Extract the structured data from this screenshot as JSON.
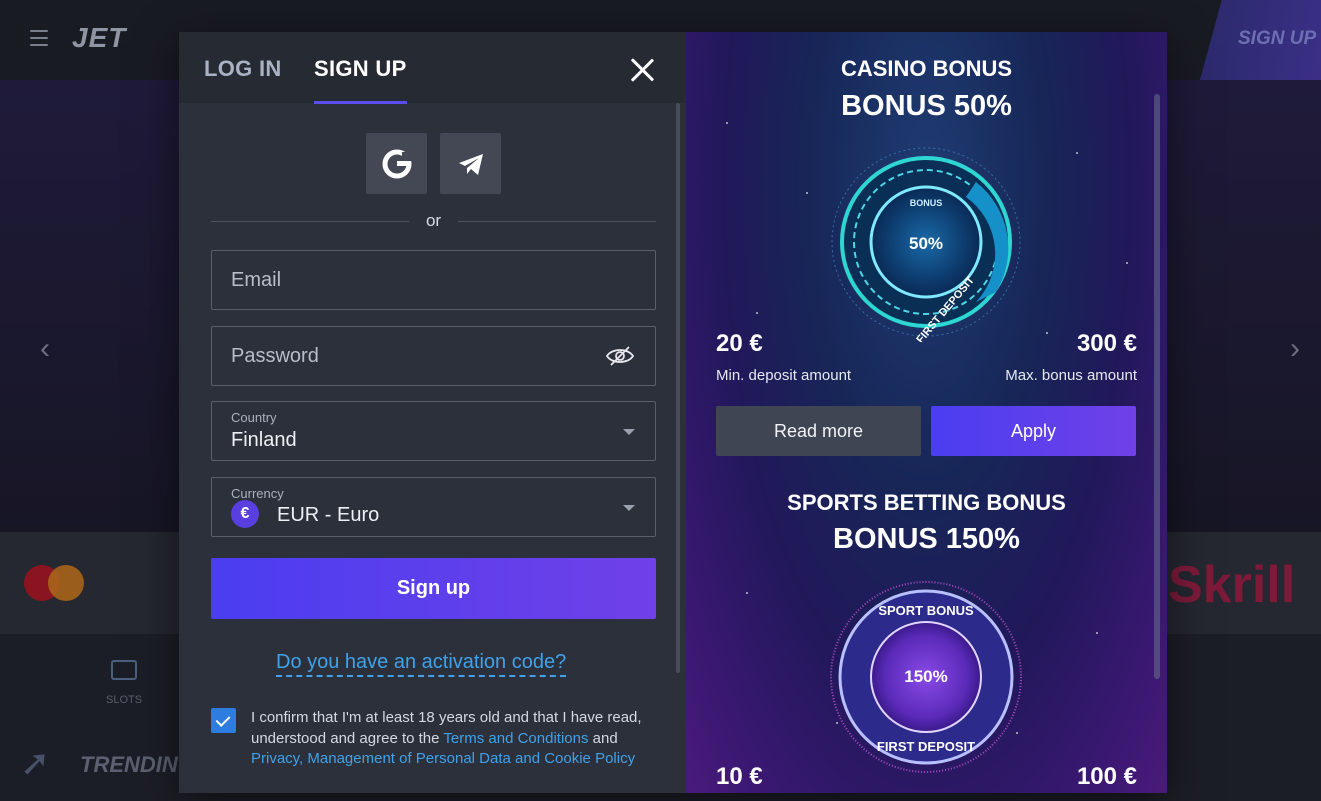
{
  "background": {
    "logo": "JET",
    "header_signup": "SIGN UP",
    "slots_label": "SLOTS",
    "trending_label": "TRENDING",
    "skrill_label": "Skrill"
  },
  "auth": {
    "tabs": {
      "login": "LOG IN",
      "signup": "SIGN UP"
    },
    "social": [
      "google-icon",
      "telegram-icon"
    ],
    "divider_text": "or",
    "email": {
      "placeholder": "Email",
      "value": ""
    },
    "password": {
      "placeholder": "Password",
      "value": ""
    },
    "country": {
      "label": "Country",
      "value": "Finland"
    },
    "currency": {
      "label": "Currency",
      "value": "EUR - Euro",
      "symbol": "€"
    },
    "signup_button": "Sign up",
    "activation_link": "Do you have an activation code?",
    "consent": {
      "checked": true,
      "text_1": "I confirm that I'm at least 18 years old and that I have read, understood and agree to the ",
      "terms_link": "Terms and Conditions",
      "text_2": " and ",
      "privacy_link": "Privacy, Management of Personal Data and Cookie Policy"
    }
  },
  "bonuses": {
    "casino": {
      "title": "CASINO BONUS",
      "headline": "BONUS 50%",
      "badge_top": "BONUS",
      "badge_value": "50%",
      "badge_ring": "FIRST DEPOSIT",
      "min_amount": "20 €",
      "min_label": "Min. deposit amount",
      "max_amount": "300 €",
      "max_label": "Max. bonus amount",
      "read_more": "Read more",
      "apply": "Apply"
    },
    "sports": {
      "title": "SPORTS BETTING BONUS",
      "headline": "BONUS 150%",
      "badge_ring_top": "SPORT BONUS",
      "badge_value": "150%",
      "badge_ring_bottom": "FIRST DEPOSIT",
      "min_amount": "10 €",
      "max_amount": "100 €"
    }
  },
  "colors": {
    "accent": "#5b4cf0",
    "link": "#3fa2ea",
    "left_panel": "#2c303b"
  }
}
